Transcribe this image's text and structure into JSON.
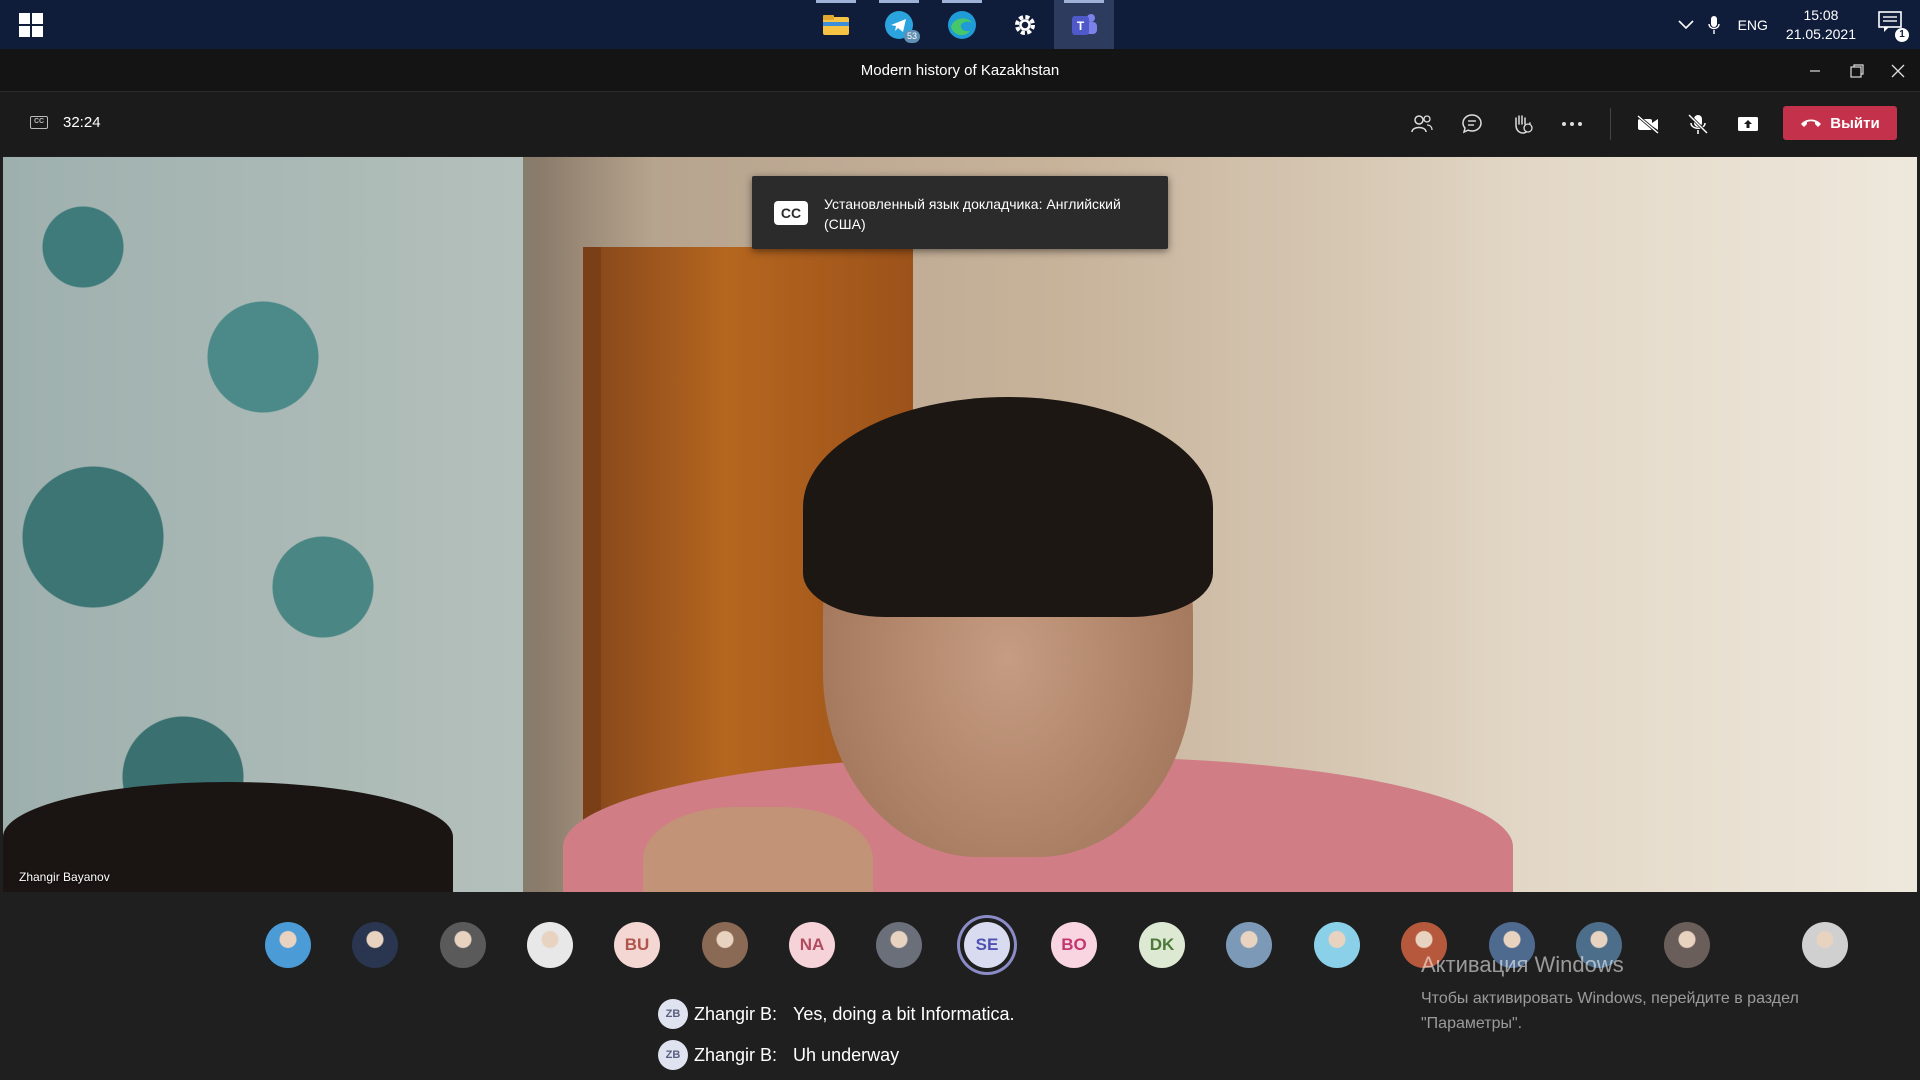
{
  "taskbar": {
    "apps": [
      "file-explorer",
      "telegram",
      "edge",
      "settings",
      "teams"
    ],
    "telegram_badge": "53",
    "language": "ENG",
    "time": "15:08",
    "date": "21.05.2021",
    "notification_count": "1"
  },
  "window": {
    "title": "Modern history of Kazakhstan"
  },
  "toolbar": {
    "timer": "32:24",
    "leave_label": "Выйти"
  },
  "video": {
    "speaker_name": "Zhangir Bayanov",
    "cc_toast_badge": "CC",
    "cc_toast_text": "Установленный язык докладчика: Английский (США)"
  },
  "participants": [
    {
      "initials": "",
      "bg": "#4a9bd6"
    },
    {
      "initials": "",
      "bg": "#2a3550"
    },
    {
      "initials": "",
      "bg": "#5a5a5a"
    },
    {
      "initials": "",
      "bg": "#e8e8e8"
    },
    {
      "initials": "BU",
      "bg": "#f4d7d3",
      "fg": "#b0554b"
    },
    {
      "initials": "",
      "bg": "#8a6a55"
    },
    {
      "initials": "NA",
      "bg": "#f6d3d9",
      "fg": "#b14b60"
    },
    {
      "initials": "",
      "bg": "#6a6f7a"
    },
    {
      "initials": "SE",
      "bg": "#d9dcf0",
      "fg": "#4f52b2"
    },
    {
      "initials": "BO",
      "bg": "#f9d5e2",
      "fg": "#c2386e"
    },
    {
      "initials": "DK",
      "bg": "#dde9d2",
      "fg": "#4d7a3a"
    },
    {
      "initials": "",
      "bg": "#7c9ab8"
    },
    {
      "initials": "",
      "bg": "#8ad0e8"
    },
    {
      "initials": "",
      "bg": "#b5583c"
    },
    {
      "initials": "",
      "bg": "#4f6a8f"
    },
    {
      "initials": "",
      "bg": "#4c6e8a"
    },
    {
      "initials": "",
      "bg": "#6a5e5a"
    },
    {
      "initials": "",
      "bg": "#d0d0d0"
    }
  ],
  "captions": [
    {
      "initials": "ZB",
      "speaker": "Zhangir B:",
      "text": "Yes, doing a bit Informatica."
    },
    {
      "initials": "ZB",
      "speaker": "Zhangir B:",
      "text": "Uh underway"
    }
  ],
  "watermark": {
    "title": "Активация Windows",
    "subtitle": "Чтобы активировать Windows, перейдите в раздел \"Параметры\"."
  }
}
